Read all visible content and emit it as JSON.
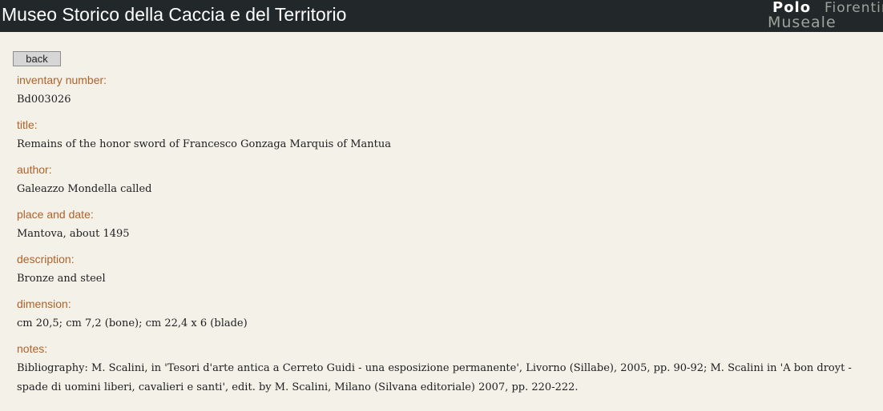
{
  "header": {
    "title": "Museo Storico della Caccia e del Territorio",
    "logo": {
      "line1": "Polo",
      "line2": "Fiorentino",
      "line3": "Museale"
    }
  },
  "back_label": "back",
  "fields": [
    {
      "label": "inventary number:",
      "value": "Bd003026"
    },
    {
      "label": "title:",
      "value": "Remains of the honor sword of Francesco Gonzaga Marquis of Mantua"
    },
    {
      "label": "author:",
      "value": "Galeazzo Mondella called"
    },
    {
      "label": "place and date:",
      "value": "Mantova, about 1495"
    },
    {
      "label": "description:",
      "value": "Bronze and steel"
    },
    {
      "label": "dimension:",
      "value": "cm 20,5; cm 7,2 (bone); cm 22,4 x 6 (blade)"
    },
    {
      "label": "notes:",
      "value": "Bibliography: M. Scalini, in 'Tesori d'arte antica a Cerreto Guidi - una esposizione permanente', Livorno (Sillabe), 2005, pp. 90-92; M. Scalini in 'A bon droyt - spade di uomini liberi, cavalieri e santi', edit. by M. Scalini, Milano (Silvana editoriale) 2007, pp. 220-222."
    }
  ],
  "colors": {
    "header_bg": "#222829",
    "page_bg": "#f3f1e8",
    "label": "#b0622a"
  }
}
